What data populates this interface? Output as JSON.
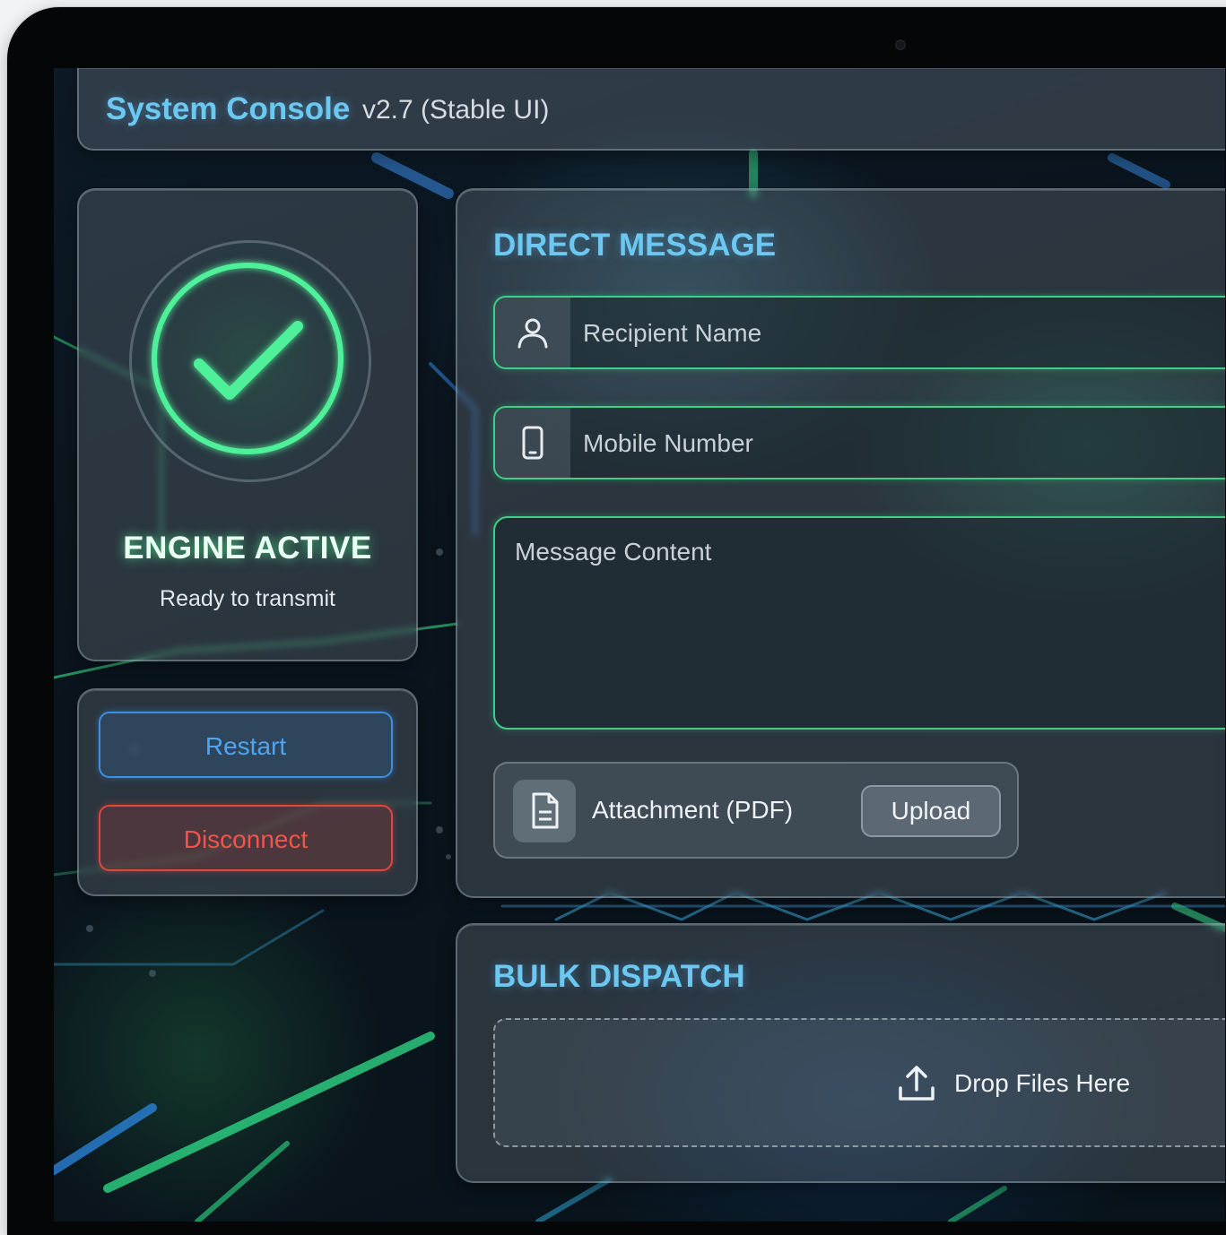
{
  "header": {
    "title": "System Console",
    "version": "v2.7 (Stable UI)"
  },
  "status": {
    "icon": "check-circle-icon",
    "state": "ENGINE ACTIVE",
    "subtitle": "Ready to transmit",
    "accent": "#3ddc84"
  },
  "controls": {
    "restart_label": "Restart",
    "disconnect_label": "Disconnect",
    "restart_color": "#3d8fe0",
    "disconnect_color": "#e0473f"
  },
  "direct_message": {
    "title": "DIRECT MESSAGE",
    "recipient_placeholder": "Recipient Name",
    "mobile_placeholder": "Mobile Number",
    "message_placeholder": "Message Content",
    "attachment_label": "Attachment (PDF)",
    "upload_label": "Upload"
  },
  "bulk_dispatch": {
    "title": "BULK DISPATCH",
    "dropzone_label": "Drop Files Here"
  },
  "colors": {
    "heading": "#6cc8f0",
    "field_border": "#3fcf86"
  }
}
